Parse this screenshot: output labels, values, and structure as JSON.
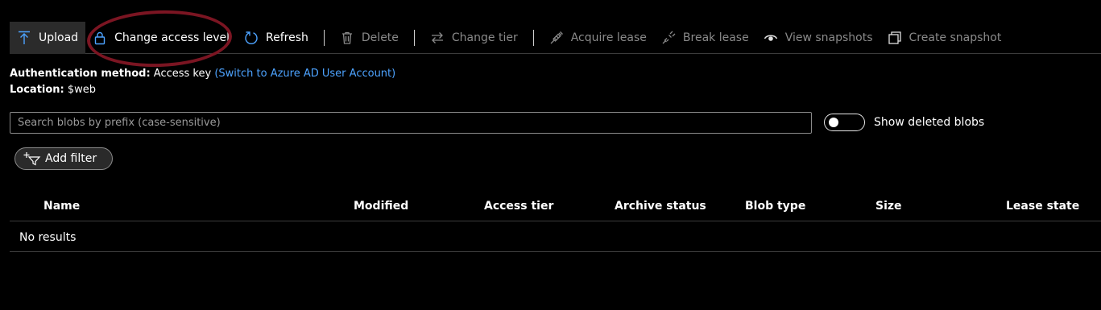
{
  "toolbar": {
    "upload": "Upload",
    "change_access_level": "Change access level",
    "refresh": "Refresh",
    "delete": "Delete",
    "change_tier": "Change tier",
    "acquire_lease": "Acquire lease",
    "break_lease": "Break lease",
    "view_snapshots": "View snapshots",
    "create_snapshot": "Create snapshot",
    "icons": [
      "upload-arrow-icon",
      "lock-icon",
      "refresh-icon",
      "trash-icon",
      "swap-arrows-icon",
      "plug-icon",
      "broken-plug-icon",
      "eye-icon",
      "snapshot-icon"
    ]
  },
  "info": {
    "auth_label": "Authentication method:",
    "auth_value": "Access key",
    "auth_link": "(Switch to Azure AD User Account)",
    "location_label": "Location:",
    "location_value": "$web"
  },
  "search": {
    "placeholder": "Search blobs by prefix (case-sensitive)",
    "value": ""
  },
  "toggle": {
    "label": "Show deleted blobs",
    "on": false
  },
  "filter": {
    "label": "Add filter"
  },
  "table": {
    "columns": [
      "Name",
      "Modified",
      "Access tier",
      "Archive status",
      "Blob type",
      "Size",
      "Lease state"
    ],
    "empty_message": "No results"
  },
  "colors": {
    "background": "#000000",
    "accent": "#4da3ff",
    "highlight_ring": "#7b1522",
    "disabled_text": "#8a8a8a"
  }
}
